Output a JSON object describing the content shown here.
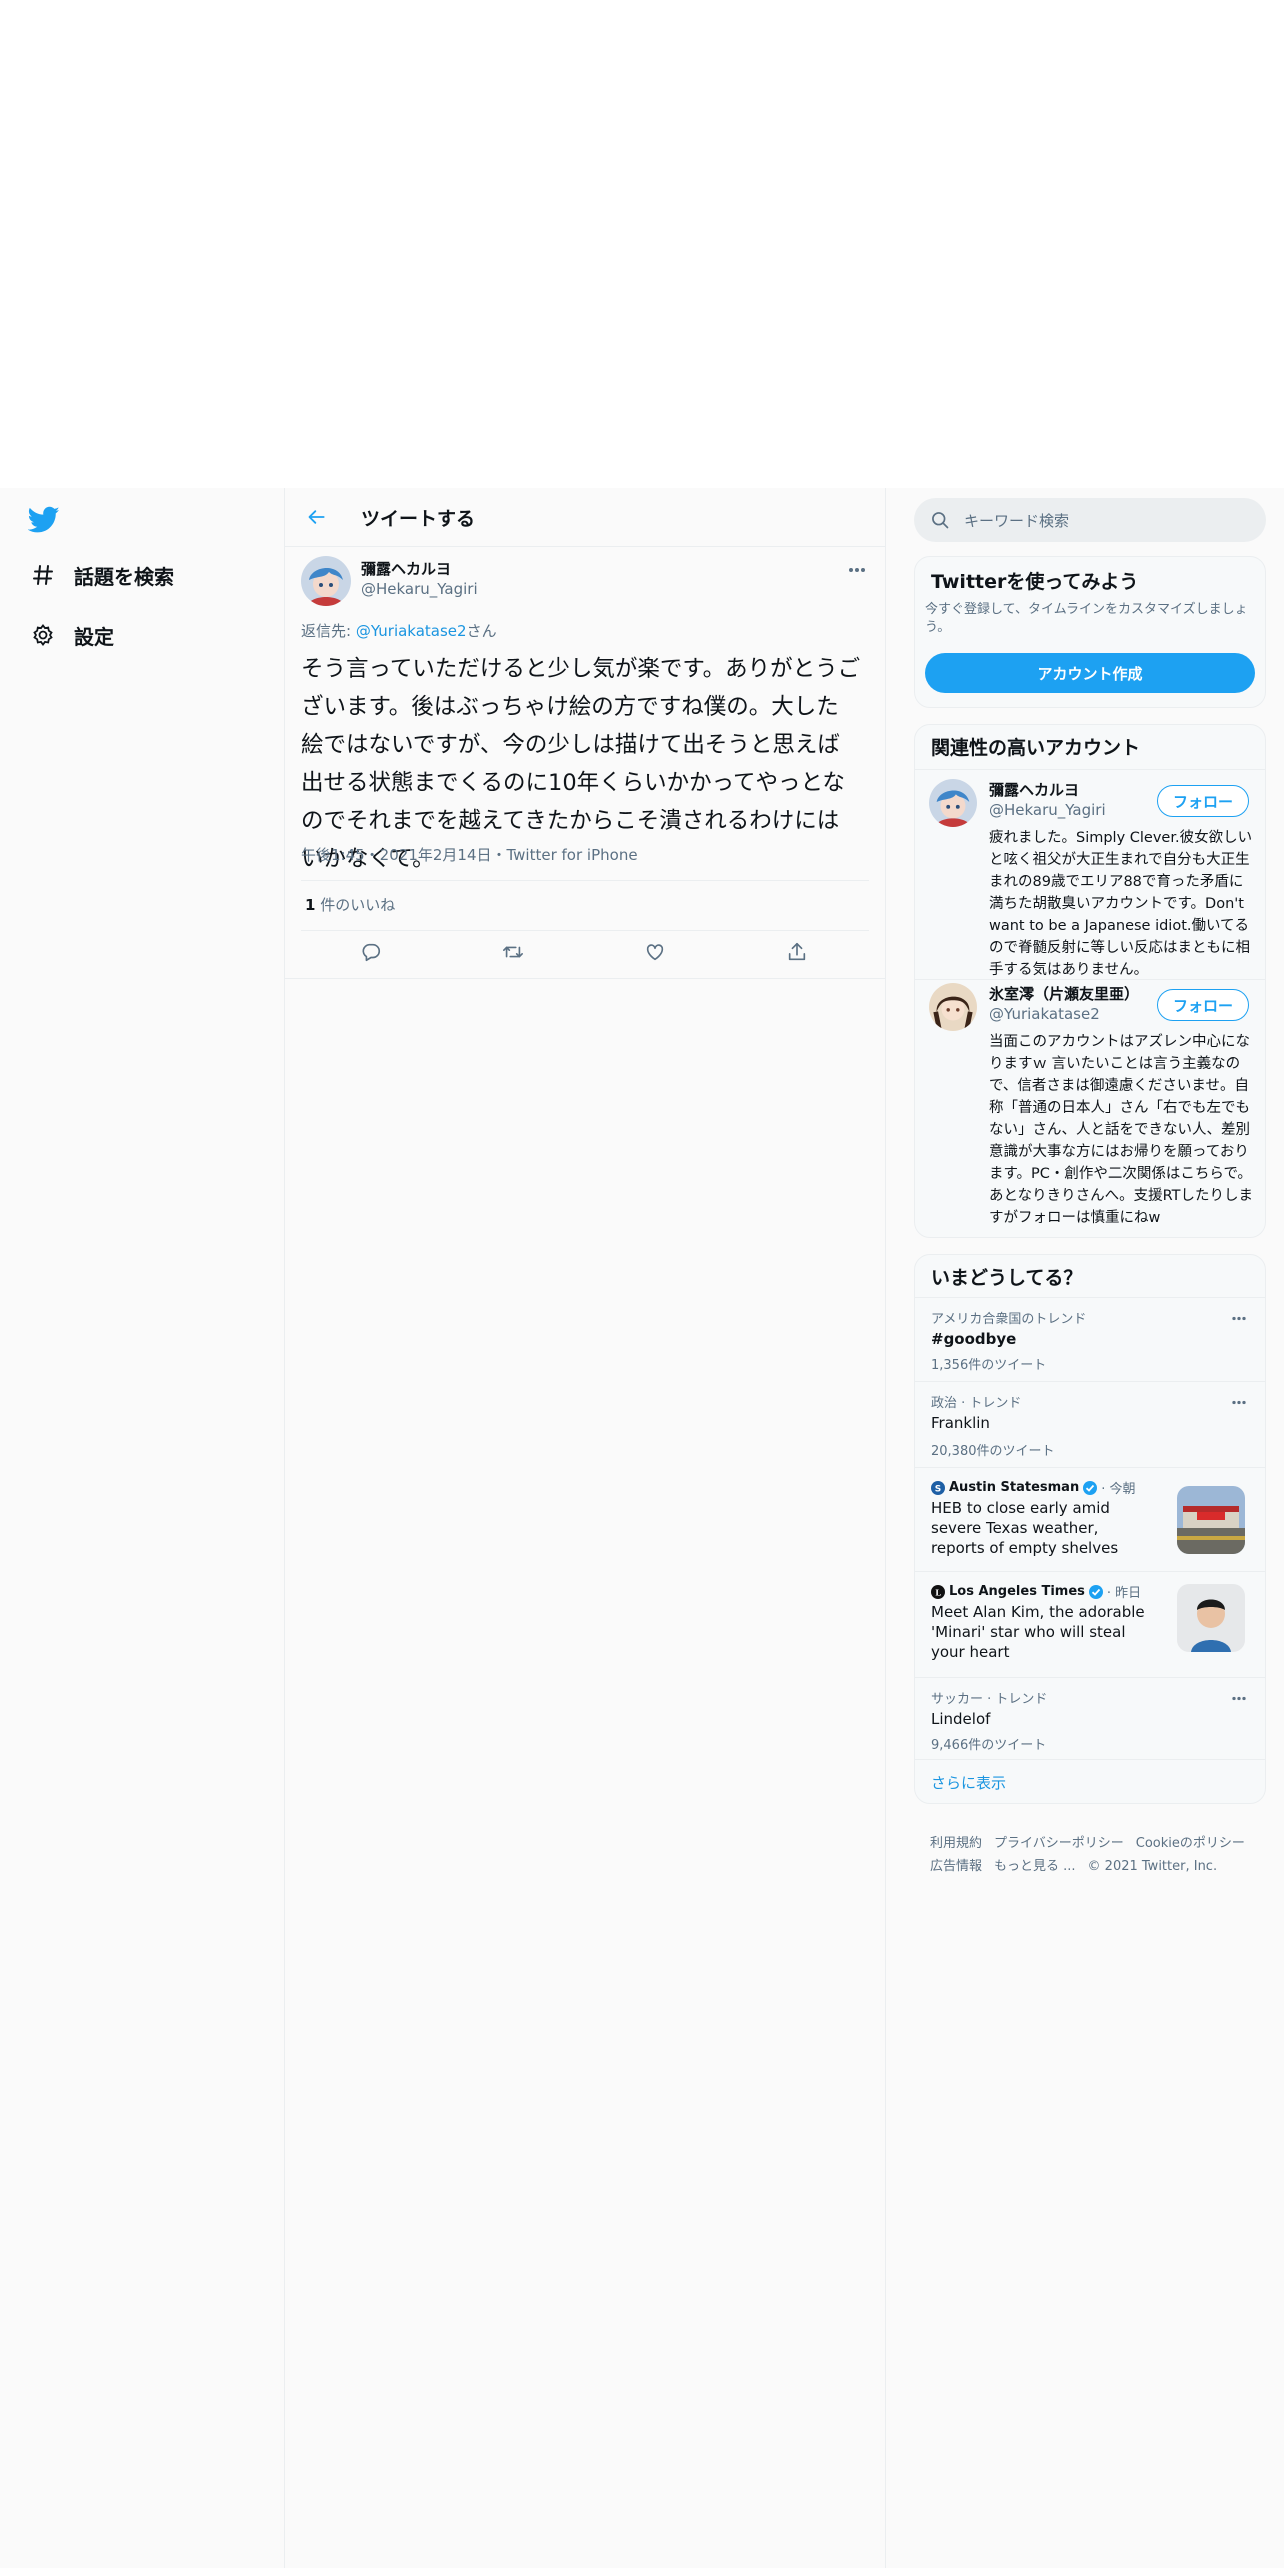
{
  "nav": {
    "explore_label": "話題を検索",
    "settings_label": "設定"
  },
  "header": {
    "title": "ツイートする"
  },
  "tweet": {
    "author_name": "彌露ヘカルヨ",
    "author_handle": "@Hekaru_Yagiri",
    "reply_prefix": "返信先: ",
    "reply_to": "@Yuriakatase2",
    "reply_suffix": "さん",
    "text": "そう言っていただけると少し気が楽です。ありがとうございます。後はぶっちゃけ絵の方ですね僕の。大した絵ではないですが、今の少しは描けて出そうと思えば出せる状態までくるのに10年くらいかかってやっとなのでそれまでを越えてきたからこそ潰されるわけにはいかなくて。",
    "meta": "午後1:45・2021年2月14日・Twitter for iPhone",
    "likes_count": "1",
    "likes_label": " 件のいいね"
  },
  "search": {
    "placeholder": "キーワード検索"
  },
  "signup": {
    "title": "Twitterを使ってみよう",
    "desc": "今すぐ登録して、タイムラインをカスタマイズしましょう。",
    "button": "アカウント作成"
  },
  "relevant": {
    "title": "関連性の高いアカウント",
    "accounts": [
      {
        "name": "彌露ヘカルヨ",
        "handle": "@Hekaru_Yagiri",
        "follow": "フォロー",
        "bio": "疲れました。Simply Clever.彼女欲しいと呟く祖父が大正生まれで自分も大正生まれの89歳でエリア88で育った矛盾に満ちた胡散臭いアカウントです。Don't want to be a Japanese idiot.働いてるので脊髄反射に等しい反応はまともに相手する気はありません。"
      },
      {
        "name": "氷室澪（片瀬友里亜）",
        "handle": "@Yuriakatase2",
        "follow": "フォロー",
        "bio": "当面このアカウントはアズレン中心になりますｗ 言いたいことは言う主義なので、信者さまは御遠慮くださいませ。自称「普通の日本人」さん「右でも左でもない」さん、人と話をできない人、差別意識が大事な方にはお帰りを願っております。PC・創作や二次関係はこちらで。あとなりきりさんへ。支援RTしたりしますがフォローは慎重にねw"
      }
    ]
  },
  "trends": {
    "title": "いまどうしてる？",
    "items": [
      {
        "context": "アメリカ合衆国のトレンド",
        "name": "#goodbye",
        "count": "1,356件のツイート"
      },
      {
        "context": "政治 · トレンド",
        "name": "Franklin",
        "count": "20,380件のツイート"
      },
      {
        "source": "Austin Statesman",
        "time": "· 今朝",
        "headline": "HEB to close early amid severe Texas weather, reports of empty shelves"
      },
      {
        "source": "Los Angeles Times",
        "time": "· 昨日",
        "headline": "Meet Alan Kim, the adorable 'Minari' star who will steal your heart"
      },
      {
        "context": "サッカー · トレンド",
        "name": "Lindelof",
        "count": "9,466件のツイート"
      }
    ],
    "show_more": "さらに表示"
  },
  "footer": {
    "links": [
      "利用規約",
      "プライバシーポリシー",
      "Cookieのポリシー",
      "広告情報",
      "もっと見る ..."
    ],
    "copyright": "© 2021 Twitter, Inc."
  },
  "colors": {
    "accent": "#1da1f2",
    "link": "#1b95e0",
    "muted": "#5b7083",
    "border": "#ebeef0"
  }
}
